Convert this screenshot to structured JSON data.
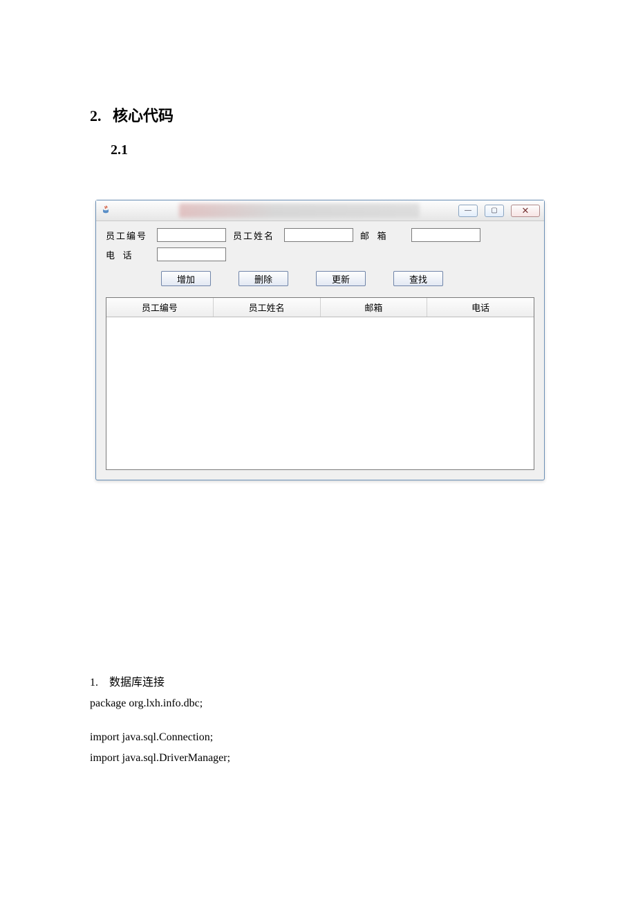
{
  "doc": {
    "heading_number": "2.",
    "heading_text": "核心代码",
    "subheading": "2.1",
    "list_item_number": "1.",
    "list_item_text": "数据库连接",
    "code_line1": "package org.lxh.info.dbc;",
    "code_line2": "import java.sql.Connection;",
    "code_line3": "import java.sql.DriverManager;"
  },
  "app": {
    "form": {
      "emp_id_label": "员工编号",
      "emp_name_label": "员工姓名",
      "email_label": "邮  箱",
      "phone_label": "电  话"
    },
    "buttons": {
      "add": "增加",
      "delete": "删除",
      "update": "更新",
      "search": "查找"
    },
    "table_headers": {
      "c1": "员工编号",
      "c2": "员工姓名",
      "c3": "邮箱",
      "c4": "电话"
    },
    "window_controls": {
      "min": "—",
      "max": "▢",
      "close": "✕"
    }
  }
}
